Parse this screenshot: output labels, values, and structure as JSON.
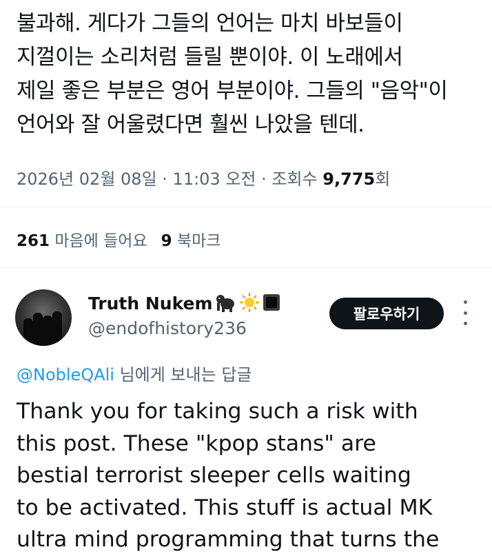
{
  "tweet_text_lines": [
    "불과해. 게다가 그들의 언어는 마치 바보들이",
    "지껄이는 소리처럼 들릴 뿐이야. 이 노래에서",
    "제일 좋은 부분은 영어 부분이야. 그들의 \"음악\"이",
    "언어와 잘 어울렸다면 훨씬 나았을 텐데."
  ],
  "meta": {
    "date": "2026년 02월 08일",
    "sep": " · ",
    "time": "11:03 오전",
    "views_label": "조회수",
    "views": "9,775",
    "views_unit": "회"
  },
  "stats": {
    "likes_count": "261",
    "likes_label": "마음에 들어요",
    "bookmarks_count": "9",
    "bookmarks_label": "북마크"
  },
  "reply": {
    "author_name": "Truth Nukem",
    "author_handle": "@endofhistory236",
    "name_emojis": [
      "gorilla-icon",
      "sun-icon",
      "black-square-icon"
    ],
    "follow_label": "팔로우하기",
    "replying_mention": "@NobleQAli",
    "replying_suffix": " 님에게 보내는 답글",
    "text_lines": [
      "Thank you for taking such a risk with",
      "this post. These \"kpop stans\" are",
      "bestial terrorist sleeper cells waiting",
      "to be activated. This stuff is actual MK",
      "ultra mind programming that turns the"
    ]
  },
  "colors": {
    "text": "#0f1419",
    "secondary": "#536471",
    "link": "#1d9bf0",
    "button": "#0f1419"
  }
}
